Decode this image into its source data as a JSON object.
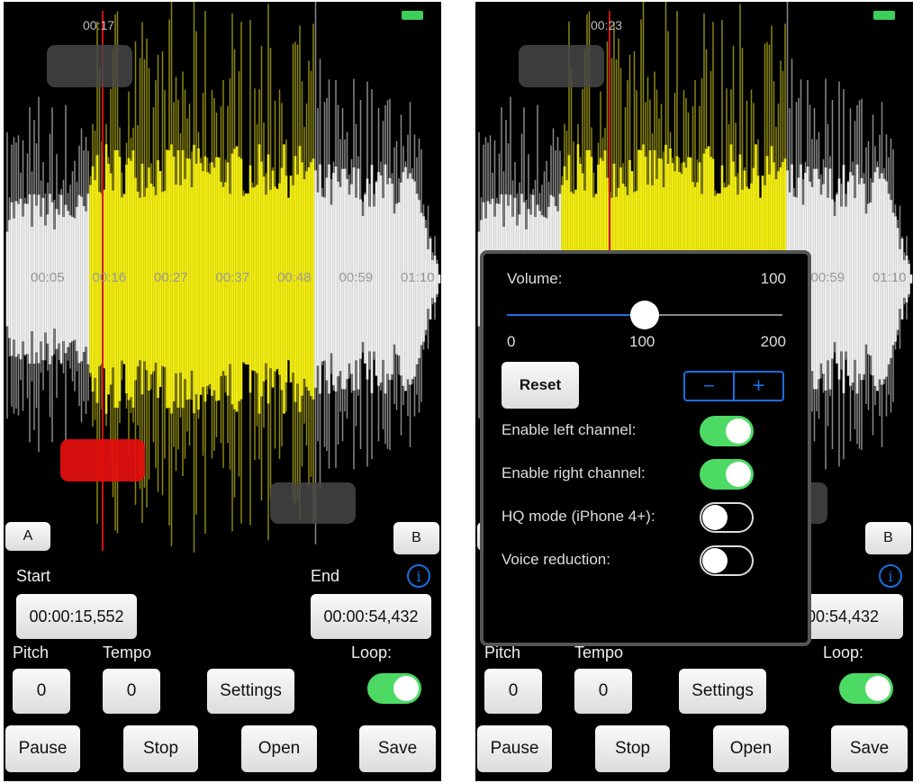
{
  "colors": {
    "selection": "#f0ea12",
    "marker": "#d01010",
    "toggle_on": "#4cd964",
    "accent": "#1a6fe0",
    "red_handle": "#e00e0e"
  },
  "timeline": [
    "00:05",
    "00:16",
    "00:27",
    "00:37",
    "00:48",
    "00:59",
    "01:10"
  ],
  "panes": [
    {
      "position": "00:17",
      "a_label": "A",
      "b_label": "B",
      "start_label": "Start",
      "end_label": "End",
      "start_value": "00:00:15,552",
      "end_value": "00:00:54,432",
      "pitch_label": "Pitch",
      "tempo_label": "Tempo",
      "loop_label": "Loop:",
      "pitch_value": "0",
      "tempo_value": "0",
      "settings_label": "Settings",
      "loop_on": true,
      "pause_label": "Pause",
      "stop_label": "Stop",
      "open_label": "Open",
      "save_label": "Save",
      "info_icon": "info-icon"
    },
    {
      "position": "00:23",
      "a_label": "",
      "b_label": "B",
      "start_label": "",
      "end_label": "",
      "start_value": "",
      "end_value": "00:54,432",
      "pitch_label": "Pitch",
      "tempo_label": "Tempo",
      "loop_label": "Loop:",
      "pitch_value": "0",
      "tempo_value": "0",
      "settings_label": "Settings",
      "loop_on": true,
      "pause_label": "Pause",
      "stop_label": "Stop",
      "open_label": "Open",
      "save_label": "Save",
      "info_icon": "info-icon"
    }
  ],
  "settings_popup": {
    "volume_label": "Volume:",
    "volume_value": "100",
    "volume": 100,
    "min": "0",
    "mid": "100",
    "max": "200",
    "reset_label": "Reset",
    "minus_label": "−",
    "plus_label": "+",
    "options": [
      {
        "label": "Enable left channel:",
        "on": true
      },
      {
        "label": "Enable right channel:",
        "on": true
      },
      {
        "label": "HQ mode (iPhone 4+):",
        "on": false
      },
      {
        "label": "Voice reduction:",
        "on": false
      }
    ]
  }
}
